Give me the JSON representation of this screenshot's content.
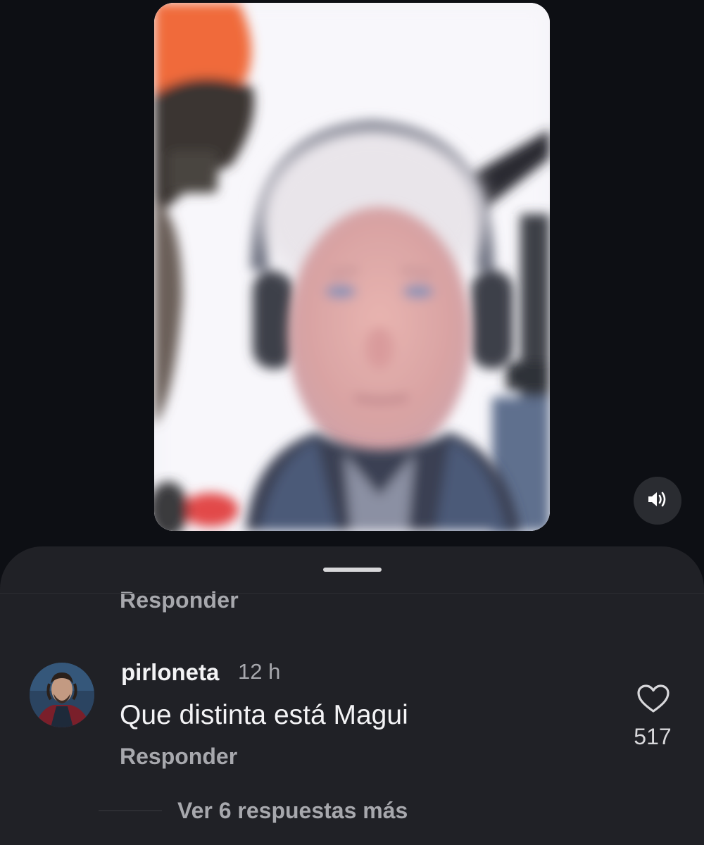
{
  "video": {
    "sound_icon": "volume-icon"
  },
  "comments": {
    "previous_reply_label": "Responder",
    "comment": {
      "username": "pirloneta",
      "time": "12 h",
      "text": "Que distinta está Magui",
      "reply_label": "Responder",
      "like_icon": "heart-outline-icon",
      "like_count": "517"
    },
    "more_replies_label": "Ver 6 respuestas más"
  }
}
